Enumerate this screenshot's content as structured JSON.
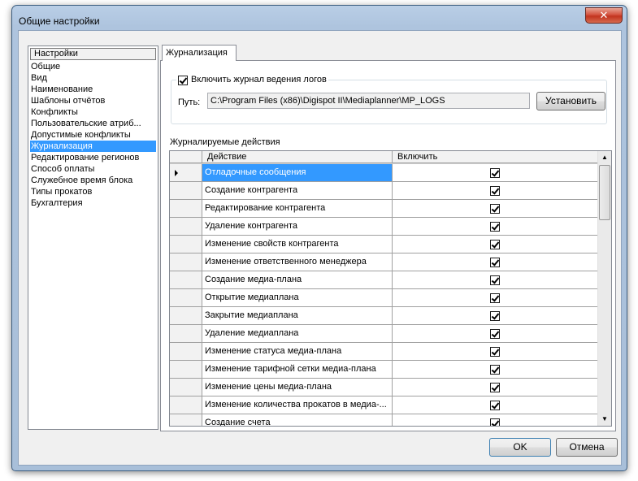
{
  "window": {
    "title": "Общие настройки",
    "close_glyph": "✕"
  },
  "tree": {
    "header": "Настройки",
    "items": [
      "Общие",
      "Вид",
      "Наименование",
      "Шаблоны отчётов",
      "Конфликты",
      "Пользовательские атриб...",
      "Допустимые конфликты",
      "Журнализация",
      "Редактирование регионов",
      "Способ оплаты",
      "Служебное время блока",
      "Типы прокатов",
      "Бухгалтерия"
    ],
    "selected": "Журнализация"
  },
  "tab": {
    "label": "Журнализация"
  },
  "logging": {
    "enable_label": "Включить журнал ведения логов",
    "enabled": true,
    "path_label": "Путь:",
    "path_value": "C:\\Program Files (x86)\\Digispot II\\Mediaplanner\\MP_LOGS",
    "set_button": "Установить"
  },
  "grid": {
    "label": "Журналируемые действия",
    "columns": [
      "",
      "Действие",
      "Включить"
    ],
    "rows": [
      {
        "action": "Отладочные сообщения",
        "enabled": true,
        "current": true
      },
      {
        "action": "Создание контрагента",
        "enabled": true
      },
      {
        "action": "Редактирование контрагента",
        "enabled": true
      },
      {
        "action": "Удаление контрагента",
        "enabled": true
      },
      {
        "action": "Изменение свойств контрагента",
        "enabled": true
      },
      {
        "action": "Изменение ответственного менеджера",
        "enabled": true
      },
      {
        "action": "Создание медиа-плана",
        "enabled": true
      },
      {
        "action": "Открытие медиаплана",
        "enabled": true
      },
      {
        "action": "Закрытие медиаплана",
        "enabled": true
      },
      {
        "action": "Удаление медиаплана",
        "enabled": true
      },
      {
        "action": "Изменение статуса медиа-плана",
        "enabled": true
      },
      {
        "action": "Изменение тарифной сетки медиа-плана",
        "enabled": true
      },
      {
        "action": "Изменение цены медиа-плана",
        "enabled": true
      },
      {
        "action": "Изменение количества прокатов в медиа-...",
        "enabled": true
      },
      {
        "action": "Создание счета",
        "enabled": true
      }
    ]
  },
  "scroll": {
    "up_glyph": "▲",
    "down_glyph": "▼"
  },
  "footer": {
    "ok": "OK",
    "cancel": "Отмена"
  },
  "colors": {
    "selection": "#3399ff",
    "frame": "#aec4de",
    "close": "#c2341f"
  }
}
